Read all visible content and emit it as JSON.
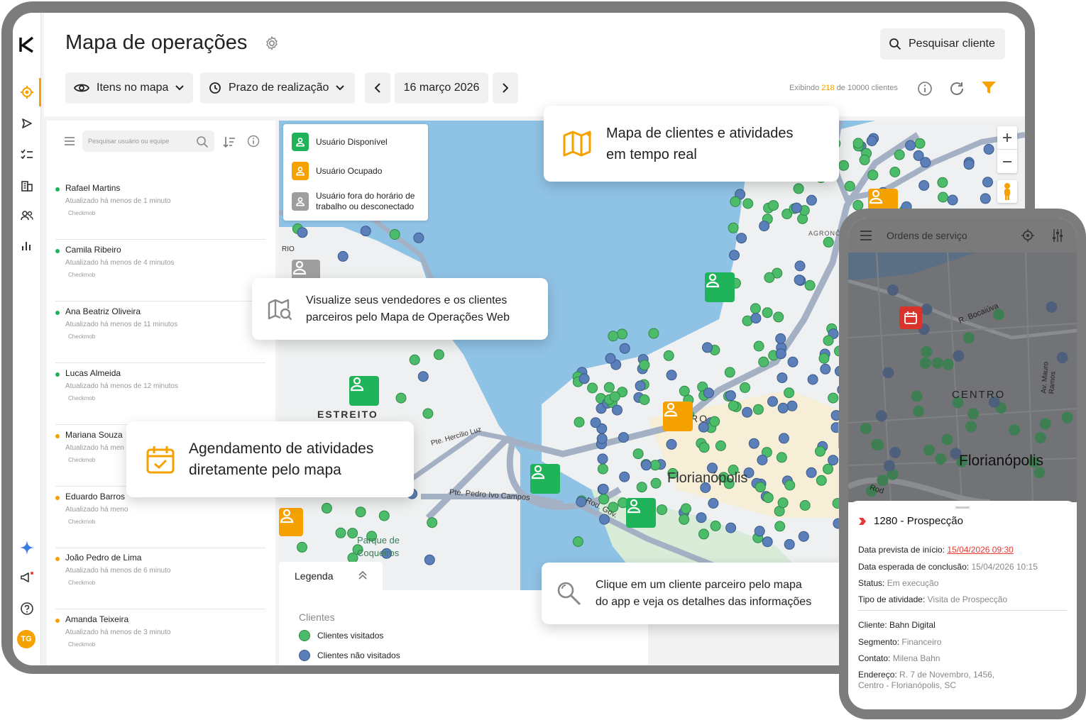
{
  "header": {
    "title": "Mapa de operações",
    "search_label": "Pesquisar cliente",
    "filters": {
      "items_label": "Itens no mapa",
      "deadline_label": "Prazo de realização",
      "date_label": "16 março 2026"
    },
    "status": {
      "prefix": "Exibindo",
      "shown": "218",
      "suffix": "de 10000 clientes"
    }
  },
  "users_panel": {
    "search_placeholder": "Pesquisar usuário ou equipe",
    "users": [
      {
        "name": "Rafael Martins",
        "updated": "Atualizado há menos de 1 minuto",
        "tag": "Checkmob",
        "status_color": "#1fb35a"
      },
      {
        "name": "Camila Ribeiro",
        "updated": "Atualizado há menos de 4 minutos",
        "tag": "Checkmob",
        "status_color": "#1fb35a"
      },
      {
        "name": "Ana Beatriz Oliveira",
        "updated": "Atualizado há menos de 11 minutos",
        "tag": "Checkmob",
        "status_color": "#1fb35a"
      },
      {
        "name": "Lucas Almeida",
        "updated": "Atualizado há menos de 12 minutos",
        "tag": "Checkmob",
        "status_color": "#1fb35a"
      },
      {
        "name": "Mariana Souza",
        "updated": "Atualizado há men",
        "tag": "Checkmob",
        "status_color": "#f5a100"
      },
      {
        "name": "Eduardo Barros",
        "updated": "Atualizado há meno",
        "tag": "Checkmob",
        "status_color": "#f5a100"
      },
      {
        "name": "João Pedro de Lima",
        "updated": "Atualizado há menos de 6 minuto",
        "tag": "Checkmob",
        "status_color": "#f5a100"
      },
      {
        "name": "Amanda Teixeira",
        "updated": "Atualizado há menos de 3 minuto",
        "tag": "Checkmob",
        "status_color": "#f5a100"
      }
    ]
  },
  "map_legend": {
    "available": "Usuário Disponível",
    "busy": "Usuário Ocupado",
    "offline_line1": "Usuário fora do horário de",
    "offline_line2": "trabalho ou desconectado"
  },
  "map_labels": {
    "city": "Florianópolis",
    "estreito": "ESTREITO",
    "bridge1": "Pte. Hercílio Luz",
    "bridge2": "Pte. Pedro Ivo Campos",
    "park_line1": "Parque de",
    "park_line2": "Coqueiros",
    "centro_partial": "RO",
    "rod": "Rod. Gov.",
    "rio": "RIO",
    "agronomica": "AGRONÔMI"
  },
  "bottom_legend": {
    "tab_label": "Legenda",
    "section": "Clientes",
    "visited": "Clientes visitados",
    "not_visited": "Clientes não visitados"
  },
  "callouts": {
    "realtime_line1": "Mapa de clientes e atividades",
    "realtime_line2": "em tempo real",
    "web_line1": "Visualize seus vendedores e os clientes",
    "web_line2": "parceiros pelo Mapa de Operações Web",
    "schedule_line1": "Agendamento de atividades",
    "schedule_line2": "diretamente pelo mapa",
    "click_line1": "Clique em um cliente parceiro pelo mapa",
    "click_line2": "do app e veja os detalhes das informações"
  },
  "phone": {
    "header_title": "Ordens de serviço",
    "map_centro": "CENTRO",
    "map_city": "Florianópolis",
    "street1": "R. Bocaiúva",
    "street2": "Av. Mauro Ramos",
    "street3": "Rod",
    "order_title": "1280 - Prospecção",
    "start_label": "Data prevista de início:",
    "start_value": "15/04/2026 09:30",
    "end_label": "Data esperada de conclusão:",
    "end_value": "15/04/2026 10:15",
    "status_label": "Status:",
    "status_value": "Em execução",
    "type_label": "Tipo de atividade:",
    "type_value": "Visita de Prospecção",
    "client_label": "Cliente:",
    "client_value": "Bahn Digital",
    "segment_label": "Segmento:",
    "segment_value": "Financeiro",
    "contact_label": "Contato:",
    "contact_value": "Milena Bahn",
    "address_label": "Endereço:",
    "address_line1": "R. 7 de Novembro, 1456,",
    "address_line2": "Centro - Florianópolis, SC"
  },
  "colors": {
    "accent": "#f5a100",
    "available": "#1fb35a",
    "offline": "#9e9e9e",
    "visited": "#4cbc6a",
    "not_visited": "#5b7fb8",
    "water": "#8fc3e6"
  }
}
